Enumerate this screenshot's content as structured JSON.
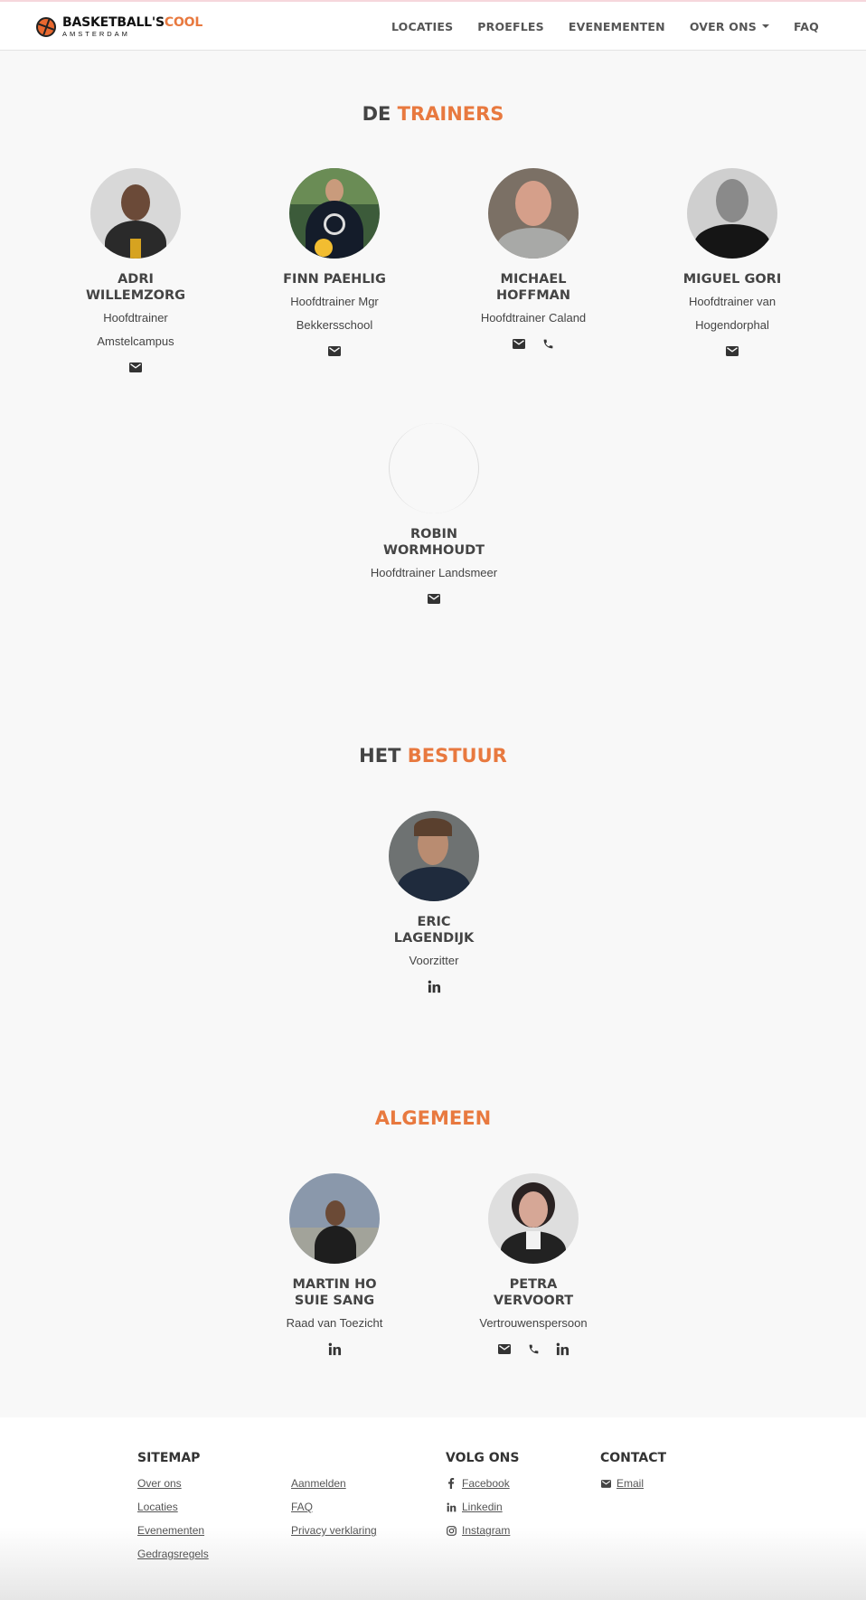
{
  "header": {
    "logo_main": "BASKETBALL'S",
    "logo_accent": "COOL",
    "logo_sub": "AMSTERDAM",
    "nav": [
      "LOCATIES",
      "PROEFLES",
      "EVENEMENTEN",
      "OVER ONS",
      "FAQ"
    ]
  },
  "sections": {
    "trainers": {
      "title_main": "DE",
      "title_accent": "TRAINERS"
    },
    "bestuur": {
      "title_main": "HET",
      "title_accent": "BESTUUR"
    },
    "algemeen": {
      "title_accent": "ALGEMEEN"
    }
  },
  "trainers": [
    {
      "name": "ADRI WILLEMZORG",
      "role": "Hoofdtrainer Amstelcampus",
      "icons": [
        "email-icon"
      ]
    },
    {
      "name": "FINN PAEHLIG",
      "role": "Hoofdtrainer Mgr Bekkersschool",
      "icons": [
        "email-icon"
      ]
    },
    {
      "name": "MICHAEL HOFFMAN",
      "role": "Hoofdtrainer Caland",
      "icons": [
        "email-icon",
        "phone-icon"
      ]
    },
    {
      "name": "MIGUEL GORI",
      "role": "Hoofdtrainer van Hogendorphal",
      "icons": [
        "email-icon"
      ]
    },
    {
      "name": "ROBIN WORMHOUDT",
      "role": "Hoofdtrainer Landsmeer",
      "icons": [
        "email-icon"
      ]
    }
  ],
  "bestuur": [
    {
      "name": "ERIC LAGENDIJK",
      "role": "Voorzitter",
      "icons": [
        "linkedin-icon"
      ]
    }
  ],
  "algemeen": [
    {
      "name": "MARTIN HO SUIE SANG",
      "role": "Raad van Toezicht",
      "icons": [
        "linkedin-icon"
      ]
    },
    {
      "name": "PETRA VERVOORT",
      "role": "Vertrouwenspersoon",
      "icons": [
        "email-icon",
        "phone-icon",
        "linkedin-icon"
      ]
    }
  ],
  "footer": {
    "sitemap_title": "SITEMAP",
    "sitemap_col1": [
      "Over ons",
      "Locaties",
      "Evenementen",
      "Gedragsregels"
    ],
    "sitemap_col2": [
      "Aanmelden",
      "FAQ",
      "Privacy verklaring"
    ],
    "volg_title": "VOLG ONS",
    "volg_links": [
      "Facebook",
      "Linkedin",
      "Instagram"
    ],
    "contact_title": "CONTACT",
    "contact_links": [
      "Email"
    ]
  },
  "colors": {
    "accent": "#e8793f",
    "text": "#444444",
    "background": "#f8f8f8"
  }
}
